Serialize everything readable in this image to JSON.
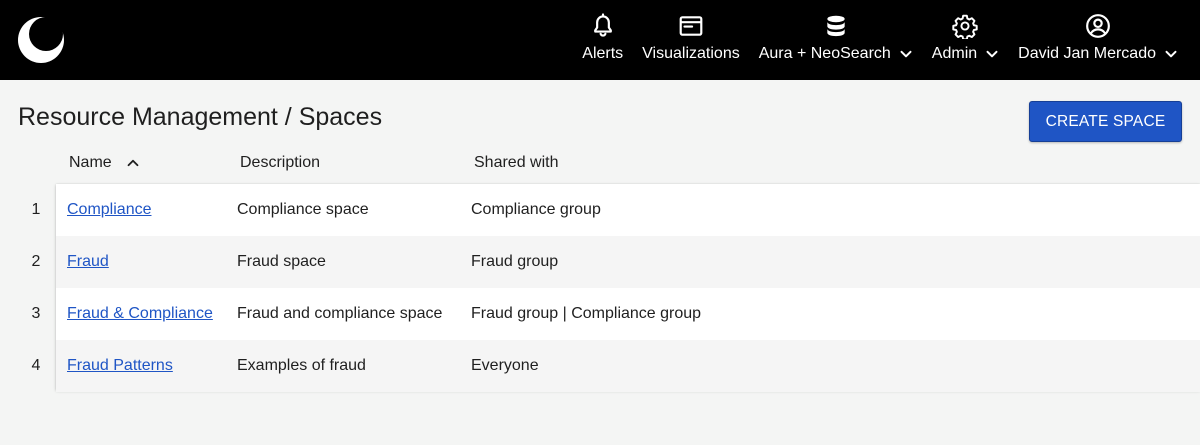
{
  "header": {
    "logo_icon": "crescent-moon-logo",
    "nav": [
      {
        "label": "Alerts",
        "icon": "bell-icon",
        "dropdown": false
      },
      {
        "label": "Visualizations",
        "icon": "window-icon",
        "dropdown": false
      },
      {
        "label": "Aura + NeoSearch",
        "icon": "database-icon",
        "dropdown": true
      },
      {
        "label": "Admin",
        "icon": "gear-icon",
        "dropdown": true
      },
      {
        "label": "David Jan Mercado",
        "icon": "user-circle-icon",
        "dropdown": true
      }
    ]
  },
  "page": {
    "title": "Resource Management / Spaces",
    "create_button": "CREATE SPACE"
  },
  "table": {
    "columns": [
      "Name",
      "Description",
      "Shared with"
    ],
    "sorted_column": "Name",
    "sort_direction": "ascending",
    "rows": [
      {
        "index": "1",
        "name": "Compliance",
        "description": "Compliance space",
        "shared_with": "Compliance group"
      },
      {
        "index": "2",
        "name": "Fraud",
        "description": "Fraud space",
        "shared_with": "Fraud group"
      },
      {
        "index": "3",
        "name": "Fraud & Compliance",
        "description": "Fraud and compliance space",
        "shared_with": "Fraud group | Compliance group"
      },
      {
        "index": "4",
        "name": "Fraud Patterns",
        "description": "Examples of fraud",
        "shared_with": "Everyone"
      }
    ]
  },
  "colors": {
    "topbar": "#000000",
    "background": "#f4f5f4",
    "accent": "#1f55c5",
    "link": "#1f55c5",
    "row_alt": "#f5f5f5"
  }
}
